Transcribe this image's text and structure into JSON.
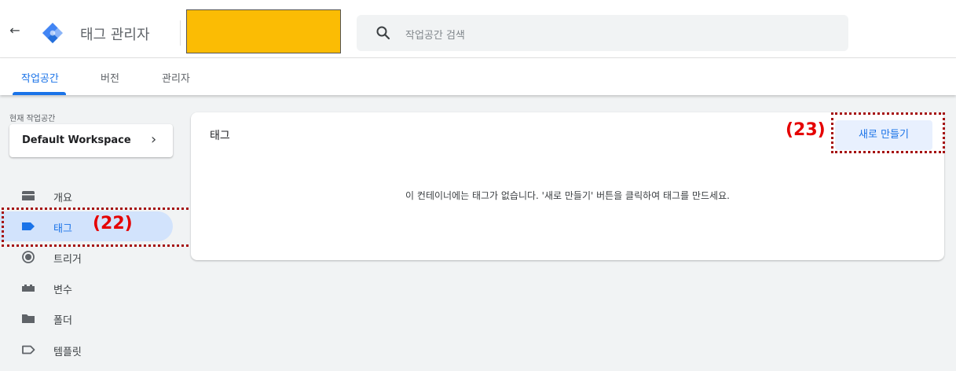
{
  "header": {
    "back_icon": "arrow-left-icon",
    "logo_icon": "gtm-logo-icon",
    "app_title": "태그 관리자",
    "account_redaction_color": "#fbbc04",
    "search_placeholder": "작업공간 검색",
    "search_icon": "search-icon"
  },
  "tabs": [
    {
      "label": "작업공간",
      "active": true
    },
    {
      "label": "버전",
      "active": false
    },
    {
      "label": "관리자",
      "active": false
    }
  ],
  "sidebar": {
    "workspace_label": "현재 작업공간",
    "workspace_name": "Default Workspace",
    "workspace_chevron": "chevron-right-icon",
    "items": [
      {
        "label": "개요",
        "icon": "overview-icon",
        "active": false
      },
      {
        "label": "태그",
        "icon": "tag-icon",
        "active": true
      },
      {
        "label": "트리거",
        "icon": "trigger-icon",
        "active": false
      },
      {
        "label": "변수",
        "icon": "variable-icon",
        "active": false
      },
      {
        "label": "폴더",
        "icon": "folder-icon",
        "active": false
      },
      {
        "label": "템플릿",
        "icon": "template-icon",
        "active": false
      }
    ]
  },
  "main": {
    "card_title": "태그",
    "new_button": "새로 만들기",
    "empty_message": "이 컨테이너에는 태그가 없습니다. '새로 만들기' 버튼을 클릭하여 태그를 만드세요."
  },
  "annotations": {
    "tag_nav": "(22)",
    "new_button": "(23)",
    "color": "#e50000"
  },
  "colors": {
    "accent": "#1a73e8",
    "active_nav_bg": "#d2e3fc"
  }
}
